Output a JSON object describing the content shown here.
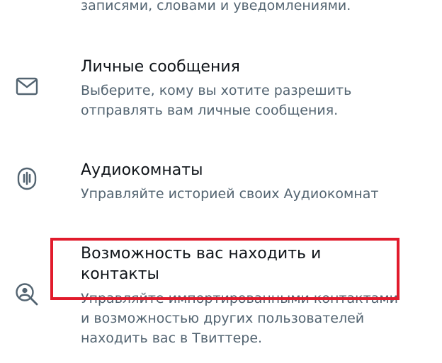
{
  "previous_item": {
    "description_tail": "записями, словами и уведомлениями."
  },
  "settings_items": [
    {
      "icon": "envelope-icon",
      "title": "Личные сообщения",
      "description_lines": [
        "Выберите, кому вы хотите разрешить",
        "отправлять вам личные сообщения."
      ]
    },
    {
      "icon": "audio-spaces-icon",
      "title": "Аудиокомнаты",
      "description_lines": [
        "Управляйте историей своих Аудиокомнат"
      ]
    },
    {
      "icon": "discoverability-search-icon",
      "title_lines": [
        "Возможность вас находить и",
        "контакты"
      ],
      "description_lines": [
        "Управляйте импортированными контактами",
        "и возможностью других пользователей",
        "находить вас в Твиттере."
      ]
    }
  ],
  "colors": {
    "primary_text": "#0f1419",
    "secondary_text": "#536471",
    "icon_stroke": "#536471",
    "highlight_border": "#e11b2c"
  }
}
